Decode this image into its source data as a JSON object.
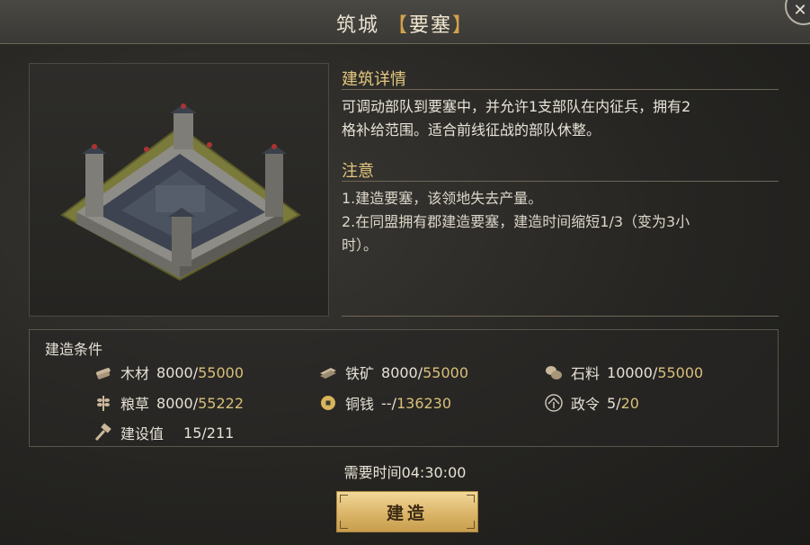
{
  "header": {
    "title_prefix": "筑城",
    "bracket_open": "【",
    "building_name": "要塞",
    "bracket_close": "】",
    "close_icon": "close-icon"
  },
  "details": {
    "heading": "建筑详情",
    "description_line1": "可调动部队到要塞中，并允许1支部队在内征兵，拥有2",
    "description_line2": "格补给范围。适合前线征战的部队休整。"
  },
  "notice": {
    "heading": "注意",
    "line1": "1.建造要塞，该领地失去产量。",
    "line2": "2.在同盟拥有郡建造要塞，建造时间缩短1/3（变为3小",
    "line3": "时）。"
  },
  "requirements": {
    "title": "建造条件",
    "items": [
      {
        "icon": "wood-icon",
        "label": "木材",
        "current": "8000",
        "required": "55000"
      },
      {
        "icon": "iron-icon",
        "label": "铁矿",
        "current": "8000",
        "required": "55000"
      },
      {
        "icon": "stone-icon",
        "label": "石料",
        "current": "10000",
        "required": "55000"
      },
      {
        "icon": "grain-icon",
        "label": "粮草",
        "current": "8000",
        "required": "55222"
      },
      {
        "icon": "coin-icon",
        "label": "铜钱",
        "current": "--",
        "required": "136230"
      },
      {
        "icon": "decree-icon",
        "label": "政令",
        "current": "5",
        "required": "20"
      },
      {
        "icon": "hammer-icon",
        "label": "建设值",
        "current": "15",
        "required": "211"
      }
    ]
  },
  "time_needed": "需要时间04:30:00",
  "build_button": "建造",
  "colors": {
    "accent_gold": "#e3c77f",
    "required_value": "#d9bf7a",
    "button_gold": "#d8b264"
  }
}
